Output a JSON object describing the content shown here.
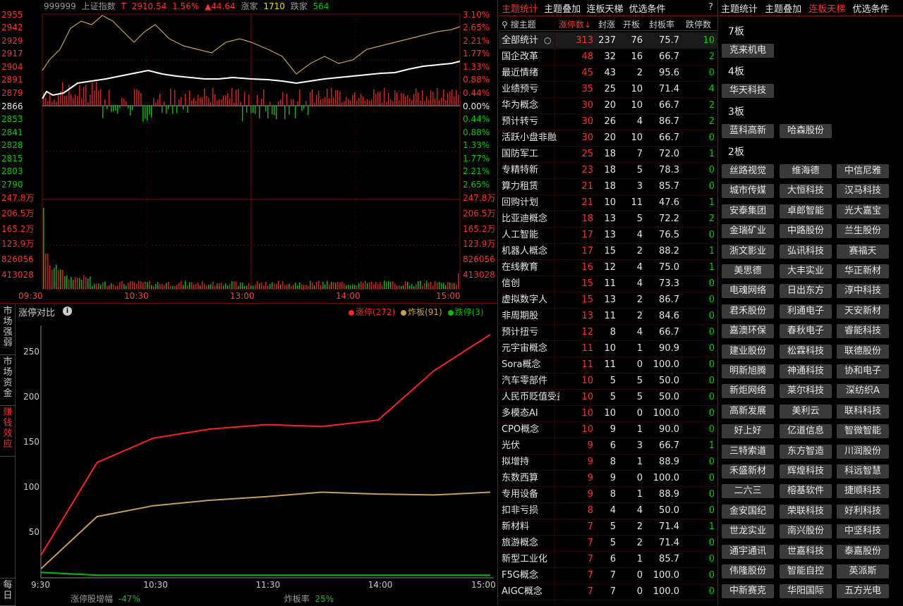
{
  "index_header": {
    "code": "999999",
    "name": "上证指数",
    "flag": "T",
    "price": "2910.54",
    "pct": "1.56%",
    "change": "▲44.64",
    "up_label": "涨家",
    "up_count": "1710",
    "down_label": "跌家",
    "down_count": "564"
  },
  "price_axis_left": [
    "2955",
    "2942",
    "2929",
    "2917",
    "2904",
    "2891",
    "2879",
    "2866",
    "2853",
    "2841",
    "2828",
    "2815",
    "2803",
    "2790"
  ],
  "price_axis_right": [
    "3.10%",
    "2.65%",
    "2.21%",
    "1.77%",
    "1.33%",
    "0.88%",
    "0.44%",
    "0.00%",
    "0.44%",
    "0.88%",
    "1.33%",
    "1.77%",
    "2.21%",
    "2.65%"
  ],
  "volume_axis_left": [
    "247.8万",
    "206.5万",
    "165.2万",
    "123.9万",
    "826056",
    "413028"
  ],
  "volume_axis_right": [
    "247.8万",
    "206.5万",
    "165.2万",
    "123.9万",
    "826056",
    "413028"
  ],
  "time_axis": [
    "09:30",
    "10:30",
    "13:00",
    "14:00",
    "15:00"
  ],
  "side_tabs": [
    {
      "label": "市场强弱"
    },
    {
      "label": "市场资金"
    },
    {
      "label": "赚钱效应"
    },
    {
      "label": "每日"
    }
  ],
  "comparison": {
    "title": "涨停对比",
    "legend": [
      {
        "label": "涨停(272)",
        "color": "#ff2020"
      },
      {
        "label": "炸板(91)",
        "color": "#c8a050"
      },
      {
        "label": "跌停(3)",
        "color": "#00c000"
      }
    ]
  },
  "chart_data": {
    "type": "line",
    "x": [
      "9:30",
      "10:00",
      "10:30",
      "11:00",
      "11:30",
      "13:30",
      "14:00",
      "14:30",
      "15:00"
    ],
    "series": [
      {
        "name": "涨停(272)",
        "color": "#ff2020",
        "values": [
          25,
          128,
          155,
          165,
          170,
          168,
          175,
          230,
          270
        ]
      },
      {
        "name": "炸板(91)",
        "color": "#c8a050",
        "values": [
          10,
          68,
          80,
          86,
          90,
          95,
          93,
          92,
          95
        ]
      },
      {
        "name": "跌停(3)",
        "color": "#00c000",
        "values": [
          6,
          3,
          3,
          3,
          3,
          3,
          3,
          3,
          3
        ]
      }
    ],
    "x_tick_labels": [
      "9:30",
      "10:30",
      "11:30",
      "14:00",
      "15:00"
    ],
    "y_tick_labels": [
      "50",
      "100",
      "150",
      "200",
      "250"
    ],
    "ylim": [
      0,
      280
    ],
    "grid": false
  },
  "bottom_stats": {
    "amp_label": "涨停股增幅",
    "amp_value": "-47%",
    "burst_label": "炸板率",
    "burst_value": "25%"
  },
  "middle": {
    "tabs": [
      {
        "label": "主题统计",
        "active": true
      },
      {
        "label": "主题叠加",
        "active": false
      },
      {
        "label": "连板天梯",
        "active": false
      },
      {
        "label": "优选条件",
        "active": false
      }
    ],
    "help": "?",
    "search_placeholder": "搜主题",
    "columns": [
      "涨停数↓",
      "封涨",
      "开板",
      "封板率",
      "跌停数"
    ],
    "rows": [
      {
        "name": "全部统计",
        "limit_up": "313",
        "sealed": "237",
        "opened": "76",
        "rate": "75.7",
        "limit_down": "10"
      },
      {
        "name": "国企改革",
        "limit_up": "48",
        "sealed": "32",
        "opened": "16",
        "rate": "66.7",
        "limit_down": "2"
      },
      {
        "name": "最近情绪",
        "limit_up": "45",
        "sealed": "43",
        "opened": "2",
        "rate": "95.6",
        "limit_down": "0"
      },
      {
        "name": "业绩预亏",
        "limit_up": "35",
        "sealed": "25",
        "opened": "10",
        "rate": "71.4",
        "limit_down": "4"
      },
      {
        "name": "华为概念",
        "limit_up": "30",
        "sealed": "20",
        "opened": "10",
        "rate": "66.7",
        "limit_down": "2"
      },
      {
        "name": "预计转亏",
        "limit_up": "30",
        "sealed": "26",
        "opened": "4",
        "rate": "86.7",
        "limit_down": "2"
      },
      {
        "name": "活跃小盘非融",
        "limit_up": "30",
        "sealed": "20",
        "opened": "10",
        "rate": "66.7",
        "limit_down": "0"
      },
      {
        "name": "国防军工",
        "limit_up": "25",
        "sealed": "18",
        "opened": "7",
        "rate": "72.0",
        "limit_down": "1"
      },
      {
        "name": "专精特新",
        "limit_up": "23",
        "sealed": "18",
        "opened": "5",
        "rate": "78.3",
        "limit_down": "0"
      },
      {
        "name": "算力租赁",
        "limit_up": "21",
        "sealed": "18",
        "opened": "3",
        "rate": "85.7",
        "limit_down": "0"
      },
      {
        "name": "回购计划",
        "limit_up": "21",
        "sealed": "10",
        "opened": "11",
        "rate": "47.6",
        "limit_down": "1"
      },
      {
        "name": "比亚迪概念",
        "limit_up": "18",
        "sealed": "13",
        "opened": "5",
        "rate": "72.2",
        "limit_down": "2"
      },
      {
        "name": "人工智能",
        "limit_up": "17",
        "sealed": "13",
        "opened": "4",
        "rate": "76.5",
        "limit_down": "0"
      },
      {
        "name": "机器人概念",
        "limit_up": "17",
        "sealed": "15",
        "opened": "2",
        "rate": "88.2",
        "limit_down": "1"
      },
      {
        "name": "在线教育",
        "limit_up": "16",
        "sealed": "12",
        "opened": "4",
        "rate": "75.0",
        "limit_down": "1"
      },
      {
        "name": "信创",
        "limit_up": "15",
        "sealed": "11",
        "opened": "4",
        "rate": "73.3",
        "limit_down": "0"
      },
      {
        "name": "虚拟数字人",
        "limit_up": "15",
        "sealed": "13",
        "opened": "2",
        "rate": "86.7",
        "limit_down": "0"
      },
      {
        "name": "非周期股",
        "limit_up": "13",
        "sealed": "11",
        "opened": "2",
        "rate": "84.6",
        "limit_down": "0"
      },
      {
        "name": "预计扭亏",
        "limit_up": "12",
        "sealed": "8",
        "opened": "4",
        "rate": "66.7",
        "limit_down": "0"
      },
      {
        "name": "元宇宙概念",
        "limit_up": "11",
        "sealed": "10",
        "opened": "1",
        "rate": "90.9",
        "limit_down": "0"
      },
      {
        "name": "Sora概念",
        "limit_up": "11",
        "sealed": "11",
        "opened": "0",
        "rate": "100.0",
        "limit_down": "0"
      },
      {
        "name": "汽车零部件",
        "limit_up": "10",
        "sealed": "5",
        "opened": "5",
        "rate": "50.0",
        "limit_down": "0"
      },
      {
        "name": "人民币贬值受益",
        "limit_up": "10",
        "sealed": "5",
        "opened": "5",
        "rate": "50.0",
        "limit_down": "0"
      },
      {
        "name": "多模态AI",
        "limit_up": "10",
        "sealed": "10",
        "opened": "0",
        "rate": "100.0",
        "limit_down": "0"
      },
      {
        "name": "CPO概念",
        "limit_up": "10",
        "sealed": "9",
        "opened": "1",
        "rate": "90.0",
        "limit_down": "0"
      },
      {
        "name": "光伏",
        "limit_up": "9",
        "sealed": "6",
        "opened": "3",
        "rate": "66.7",
        "limit_down": "1"
      },
      {
        "name": "拟增持",
        "limit_up": "9",
        "sealed": "8",
        "opened": "1",
        "rate": "88.9",
        "limit_down": "0"
      },
      {
        "name": "东数西算",
        "limit_up": "9",
        "sealed": "9",
        "opened": "0",
        "rate": "100.0",
        "limit_down": "0"
      },
      {
        "name": "专用设备",
        "limit_up": "9",
        "sealed": "8",
        "opened": "1",
        "rate": "88.9",
        "limit_down": "0"
      },
      {
        "name": "扣非亏损",
        "limit_up": "8",
        "sealed": "4",
        "opened": "4",
        "rate": "50.0",
        "limit_down": "0"
      },
      {
        "name": "新材料",
        "limit_up": "7",
        "sealed": "5",
        "opened": "2",
        "rate": "71.4",
        "limit_down": "1"
      },
      {
        "name": "旅游概念",
        "limit_up": "7",
        "sealed": "5",
        "opened": "2",
        "rate": "71.4",
        "limit_down": "0"
      },
      {
        "name": "新型工业化",
        "limit_up": "7",
        "sealed": "6",
        "opened": "1",
        "rate": "85.7",
        "limit_down": "0"
      },
      {
        "name": "F5G概念",
        "limit_up": "7",
        "sealed": "7",
        "opened": "0",
        "rate": "100.0",
        "limit_down": "0"
      },
      {
        "name": "AIGC概念",
        "limit_up": "7",
        "sealed": "7",
        "opened": "0",
        "rate": "100.0",
        "limit_down": "0"
      }
    ]
  },
  "ladder": {
    "tabs": [
      {
        "label": "主题统计",
        "active": false
      },
      {
        "label": "主题叠加",
        "active": false
      },
      {
        "label": "连板天梯",
        "active": true
      },
      {
        "label": "优选条件",
        "active": false
      }
    ],
    "levels": [
      {
        "label": "7板",
        "stocks": [
          "克来机电"
        ]
      },
      {
        "label": "4板",
        "stocks": [
          "华天科技"
        ]
      },
      {
        "label": "3板",
        "stocks": [
          "蓝科高新",
          "哈森股份"
        ]
      },
      {
        "label": "2板",
        "stocks": [
          "丝路视觉",
          "维海德",
          "中信尼雅",
          "城市传媒",
          "大恒科技",
          "汉马科技",
          "安泰集团",
          "卓郎智能",
          "光大嘉宝",
          "金瑞矿业",
          "中路股份",
          "兰生股份",
          "浙文影业",
          "弘讯科技",
          "赛福天",
          "美思德",
          "大丰实业",
          "华正新材",
          "电魂网络",
          "日出东方",
          "淳中科技",
          "君禾股份",
          "利通电子",
          "天安新材",
          "嘉澳环保",
          "春秋电子",
          "睿能科技",
          "建业股份",
          "松霖科技",
          "联德股份",
          "明新旭腾",
          "神通科技",
          "协和电子",
          "新炬网络",
          "莱尔科技",
          "深纺织A",
          "高新发展",
          "美利云",
          "联科科技",
          "好上好",
          "亿道信息",
          "智微智能",
          "三特索道",
          "东方智造",
          "川润股份",
          "禾盛新材",
          "辉煌科技",
          "科远智慧",
          "二六三",
          "榕基软件",
          "捷顺科技",
          "金安国纪",
          "荣联科技",
          "好利科技",
          "世龙实业",
          "南兴股份",
          "中坚科技",
          "通宇通讯",
          "世嘉科技",
          "泰嘉股份",
          "伟隆股份",
          "智能自控",
          "英派斯",
          "中新赛克",
          "华阳国际",
          "五方光电"
        ]
      }
    ]
  }
}
